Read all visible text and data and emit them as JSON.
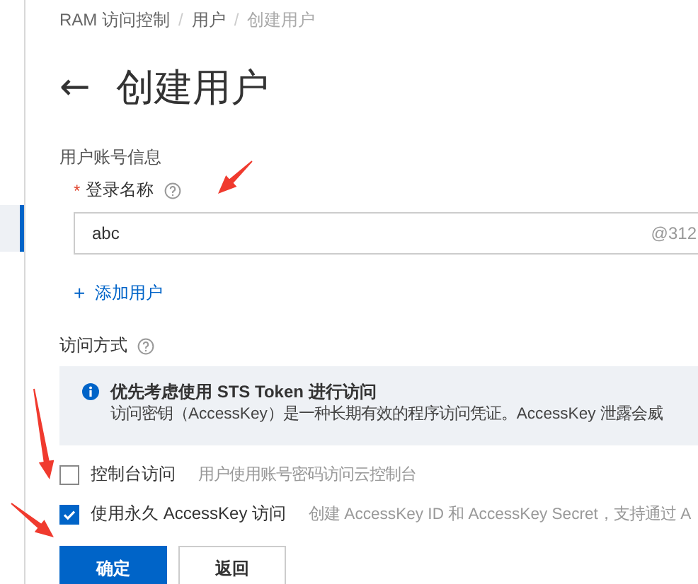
{
  "sidebar_items": [
    {
      "selected": true
    }
  ],
  "breadcrumb": [
    {
      "label": "RAM 访问控制",
      "current": false
    },
    {
      "label": "用户",
      "current": false
    },
    {
      "label": "创建用户",
      "current": true
    }
  ],
  "breadcrumb_separator": "/",
  "back_icon": "←",
  "title": "创建用户",
  "section_title": "用户账号信息",
  "login_field": {
    "required_mark": "*",
    "label": "登录名称",
    "value": "abc",
    "suffix": "@312"
  },
  "add_user_link": {
    "icon": "+",
    "label": "添加用户"
  },
  "access_section": {
    "label": "访问方式",
    "alert": {
      "title": "优先考虑使用 STS Token 进行访问",
      "text": "访问密钥（AccessKey）是一种长期有效的程序访问凭证。AccessKey 泄露会威"
    },
    "options": [
      {
        "label": "控制台访问",
        "hint": "用户使用账号密码访问云控制台",
        "checked": false
      },
      {
        "label": "使用永久 AccessKey 访问",
        "hint": "创建 AccessKey ID 和 AccessKey Secret，支持通过 A",
        "checked": true
      }
    ]
  },
  "buttons": [
    {
      "label": "确定",
      "kind": "primary"
    },
    {
      "label": "返回",
      "kind": "secondary"
    }
  ],
  "annotations": [
    {
      "kind": "arrow"
    },
    {
      "kind": "arrow"
    },
    {
      "kind": "arrow"
    }
  ]
}
